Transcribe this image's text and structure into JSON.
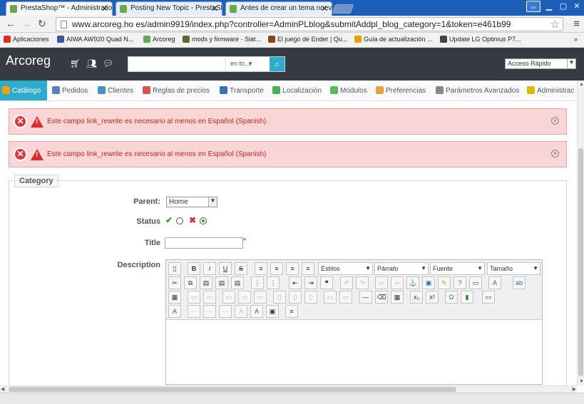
{
  "browser": {
    "tabs": [
      {
        "title": "PrestaShop™ - Administratio",
        "active": true
      },
      {
        "title": "Posting New Topic - PrestaSh",
        "active": false
      },
      {
        "title": "Antes de crear un tema nuev",
        "active": false
      }
    ],
    "url": "www.arcoreg.ho  es/admin9919/index.php?controller=AdminPLblog&submitAddpl_blog_category=1&token=e461b99",
    "bookmarks": [
      {
        "label": "Aplicaciones",
        "color": "#d93025"
      },
      {
        "label": "AIWA AW920 Quad N...",
        "color": "#3b5998"
      },
      {
        "label": "Arcoreg",
        "color": "#6aa84f"
      },
      {
        "label": "mods y firmware - Slat...",
        "color": "#556b2f"
      },
      {
        "label": "El juego de Ender | Qu...",
        "color": "#8b4513"
      },
      {
        "label": "Guía de actualización ...",
        "color": "#e6a100"
      },
      {
        "label": "Update LG Optimus P7...",
        "color": "#444444"
      }
    ]
  },
  "header": {
    "brand": "Arcoreg",
    "search_placeholder": "",
    "search_scope": "en to...",
    "quick_access": "Acceso Rápido"
  },
  "nav": [
    {
      "label": "Catálogo",
      "active": true,
      "color": "#f0a30a"
    },
    {
      "label": "Pedidos",
      "active": false,
      "color": "#5b7fbf"
    },
    {
      "label": "Clientes",
      "active": false,
      "color": "#4a90c2"
    },
    {
      "label": "Reglas de precios",
      "active": false,
      "color": "#d9534f"
    },
    {
      "label": "Transporte",
      "active": false,
      "color": "#3c6fb5"
    },
    {
      "label": "Localización",
      "active": false,
      "color": "#4caf50"
    },
    {
      "label": "Módulos",
      "active": false,
      "color": "#5cb85c"
    },
    {
      "label": "Preferencias",
      "active": false,
      "color": "#e8a33c"
    },
    {
      "label": "Parámetros Avanzados",
      "active": false,
      "color": "#888888"
    },
    {
      "label": "Administrac",
      "active": false,
      "color": "#e2b500"
    }
  ],
  "alerts": [
    {
      "message": "Este campo link_rewrite es necesario al menos en Español (Spanish)"
    },
    {
      "message": "Este campo link_rewrite es necesario al menos en Español (Spanish)"
    }
  ],
  "form": {
    "legend": "Category",
    "parent_label": "Parent:",
    "parent_value": "Home",
    "status_label": "Status",
    "title_label": "Title",
    "title_value": "",
    "description_label": "Description",
    "editor": {
      "styles": "Estilos",
      "format": "Párrafo",
      "font": "Fuente",
      "size": "Tamaño"
    }
  }
}
